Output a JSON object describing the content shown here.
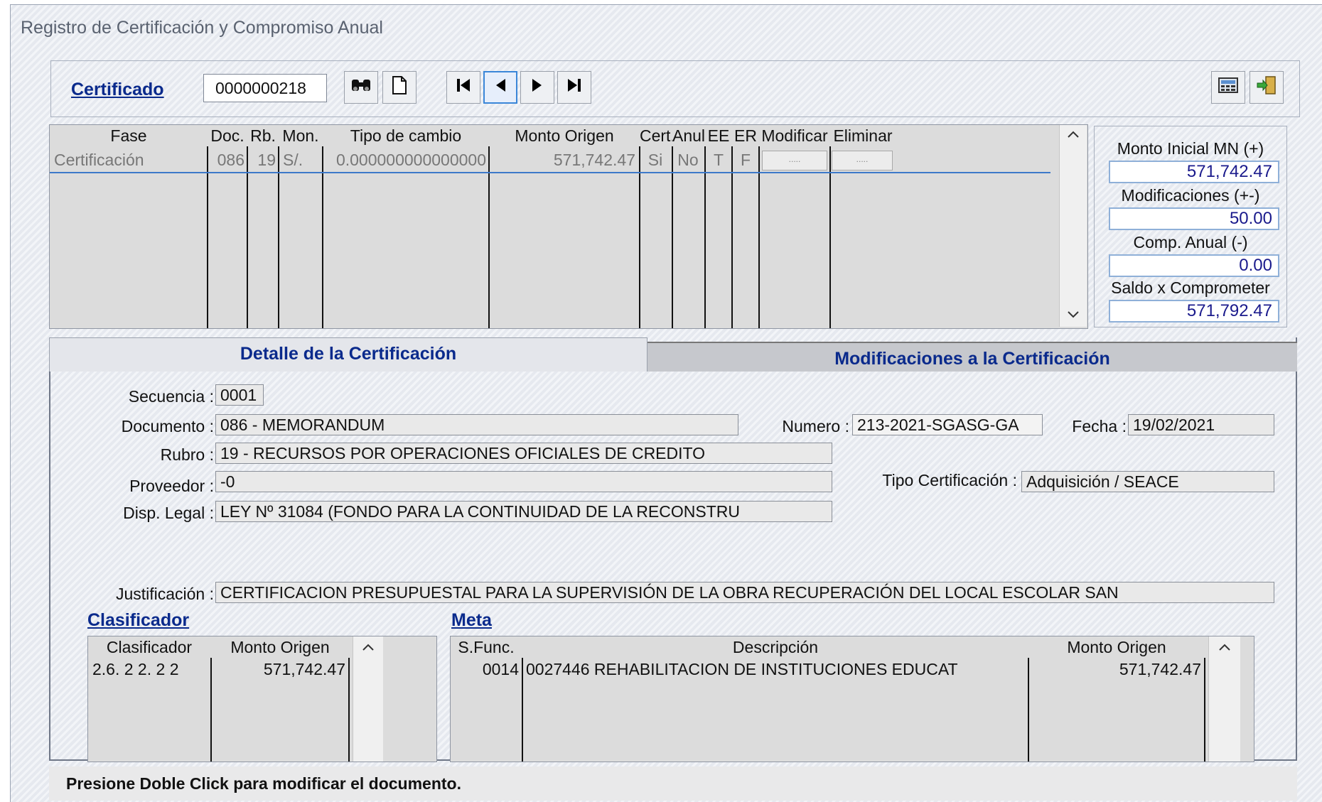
{
  "window": {
    "title": "Registro de Certificación y Compromiso Anual"
  },
  "toolbar": {
    "cert_label": "Certificado",
    "cert_value": "0000000218",
    "icons": [
      "binoculars-icon",
      "new-document-icon",
      "first-record-icon",
      "previous-record-icon",
      "next-record-icon",
      "last-record-icon",
      "calculator-icon",
      "exit-icon"
    ]
  },
  "grid": {
    "headers": [
      "Fase",
      "Doc.",
      "Rb.",
      "Mon.",
      "Tipo de cambio",
      "Monto Origen",
      "Cert.",
      "Anul",
      "EE",
      "ER",
      "Modificar",
      "Eliminar"
    ],
    "row": {
      "fase": "Certificación",
      "doc": "086",
      "rb": "19",
      "mon": "S/.",
      "tipo_cambio": "0.000000000000000",
      "monto_origen": "571,742.47",
      "cert": "Si",
      "anul": "No",
      "ee": "T",
      "er": "F",
      "modificar": ".....",
      "eliminar": "....."
    }
  },
  "totals": {
    "monto_inicial_label": "Monto Inicial MN (+)",
    "monto_inicial": "571,742.47",
    "modificaciones_label": "Modificaciones (+-)",
    "modificaciones": "50.00",
    "comp_anual_label": "Comp. Anual (-)",
    "comp_anual": "0.00",
    "saldo_label": "Saldo x Comprometer",
    "saldo": "571,792.47"
  },
  "tabs": {
    "detalle": "Detalle de la Certificación",
    "modificaciones": "Modificaciones a la Certificación"
  },
  "detalle": {
    "secuencia_label": "Secuencia :",
    "secuencia": "0001",
    "documento_label": "Documento :",
    "documento": "086 - MEMORANDUM",
    "numero_label": "Numero :",
    "numero": "213-2021-SGASG-GA",
    "fecha_label": "Fecha :",
    "fecha": "19/02/2021",
    "rubro_label": "Rubro :",
    "rubro": "19 - RECURSOS POR OPERACIONES OFICIALES DE CREDITO",
    "proveedor_label": "Proveedor :",
    "proveedor": "-0",
    "tipo_cert_label": "Tipo Certificación :",
    "tipo_cert": "Adquisición / SEACE",
    "disp_legal_label": "Disp. Legal :",
    "disp_legal": "LEY Nº 31084 (FONDO PARA LA CONTINUIDAD DE LA RECONSTRU",
    "justificacion_label": "Justificación :",
    "justificacion": "CERTIFICACION PRESUPUESTAL PARA LA SUPERVISIÓN DE LA OBRA RECUPERACIÓN DEL LOCAL ESCOLAR SAN"
  },
  "clasificador": {
    "title": "Clasificador",
    "headers": [
      "Clasificador",
      "Monto Origen"
    ],
    "rows": [
      {
        "clasificador": "2.6. 2 2. 2 2",
        "monto": "571,742.47"
      }
    ]
  },
  "meta": {
    "title": "Meta",
    "headers": [
      "S.Func.",
      "Descripción",
      "Monto Origen"
    ],
    "rows": [
      {
        "sfunc": "0014",
        "descripcion": "0027446  REHABILITACION DE INSTITUCIONES EDUCAT",
        "monto": "571,742.47"
      }
    ]
  },
  "status": {
    "message": "Presione Doble Click para modificar el documento."
  }
}
